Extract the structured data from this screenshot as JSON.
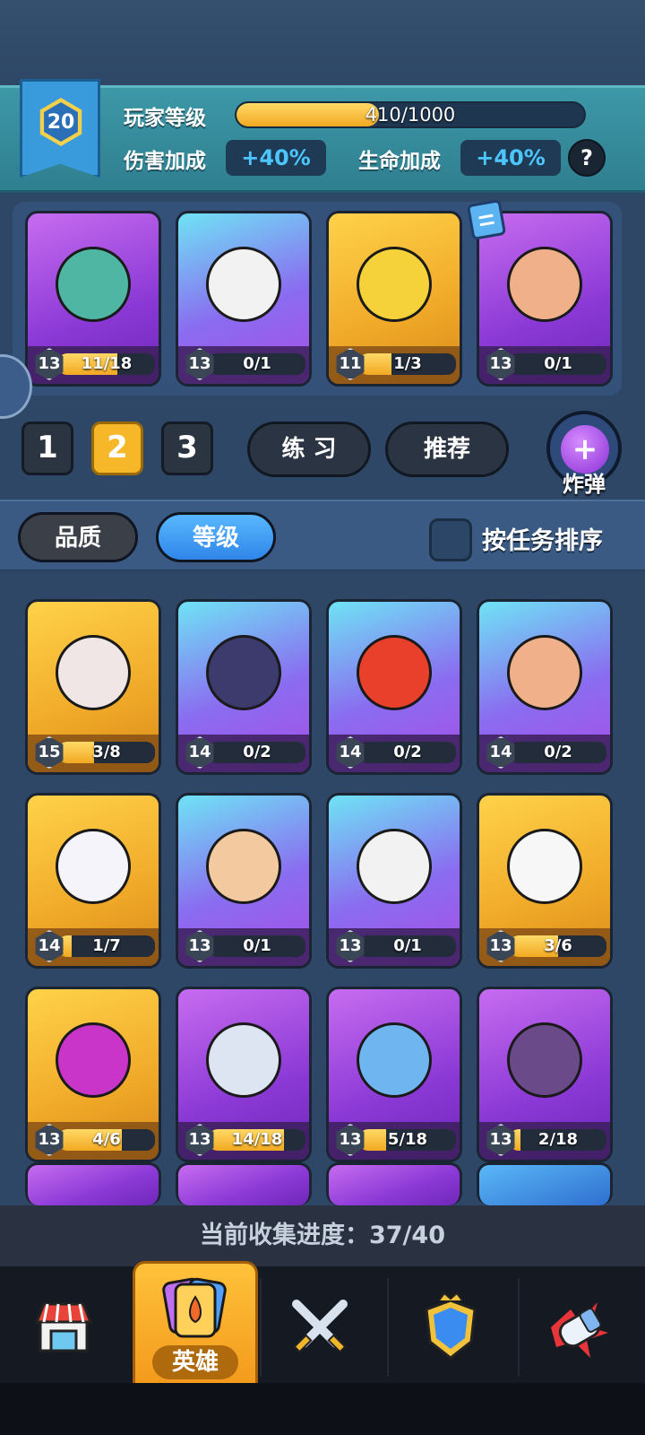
{
  "player": {
    "level": "20",
    "level_label": "玩家等级",
    "xp_text": "410/1000",
    "xp_progress": 0.41,
    "damage_label": "伤害加成",
    "damage_value": "+40%",
    "hp_label": "生命加成",
    "hp_value": "+40%",
    "help": "?"
  },
  "deck": [
    {
      "level": "13",
      "progress_text": "11/18",
      "progress": 0.61,
      "rarity": "purple",
      "face": "#4fb6a4"
    },
    {
      "level": "13",
      "progress_text": "0/1",
      "progress": 0,
      "rarity": "blue",
      "face": "#f2f2f2"
    },
    {
      "level": "11",
      "progress_text": "1/3",
      "progress": 0.33,
      "rarity": "gold",
      "face": "#f5d23a"
    },
    {
      "level": "13",
      "progress_text": "0/1",
      "progress": 0,
      "rarity": "purple",
      "face": "#f0b08a"
    }
  ],
  "deck_tabs": [
    "1",
    "2",
    "3"
  ],
  "active_deck_tab": 1,
  "buttons": {
    "practice": "练 习",
    "recommend": "推荐",
    "bomb": "炸弹",
    "bomb_plus": "+"
  },
  "filters": {
    "quality": "品质",
    "level": "等级",
    "sort_by_task": "按任务排序"
  },
  "heroes": [
    {
      "level": "15",
      "progress_text": "3/8",
      "progress": 0.37,
      "rarity": "gold",
      "face": "#f0e6e6"
    },
    {
      "level": "14",
      "progress_text": "0/2",
      "progress": 0,
      "rarity": "blue",
      "face": "#3d3a6e"
    },
    {
      "level": "14",
      "progress_text": "0/2",
      "progress": 0,
      "rarity": "blue",
      "face": "#e8402a"
    },
    {
      "level": "14",
      "progress_text": "0/2",
      "progress": 0,
      "rarity": "blue",
      "face": "#f0b08a"
    },
    {
      "level": "14",
      "progress_text": "1/7",
      "progress": 0.14,
      "rarity": "gold",
      "face": "#f4f4fa"
    },
    {
      "level": "13",
      "progress_text": "0/1",
      "progress": 0,
      "rarity": "blue",
      "face": "#f3c9a0"
    },
    {
      "level": "13",
      "progress_text": "0/1",
      "progress": 0,
      "rarity": "blue",
      "face": "#f2f2f2"
    },
    {
      "level": "13",
      "progress_text": "3/6",
      "progress": 0.5,
      "rarity": "gold",
      "face": "#f7f7f7"
    },
    {
      "level": "13",
      "progress_text": "4/6",
      "progress": 0.66,
      "rarity": "gold",
      "face": "#c935c9"
    },
    {
      "level": "13",
      "progress_text": "14/18",
      "progress": 0.78,
      "rarity": "purple",
      "face": "#dde4f2"
    },
    {
      "level": "13",
      "progress_text": "5/18",
      "progress": 0.28,
      "rarity": "purple",
      "face": "#6fb6f0"
    },
    {
      "level": "13",
      "progress_text": "2/18",
      "progress": 0.11,
      "rarity": "purple",
      "face": "#6b4a8a"
    }
  ],
  "collection": {
    "text": "当前收集进度：37/40"
  },
  "nav": {
    "heroes_label": "英雄"
  }
}
